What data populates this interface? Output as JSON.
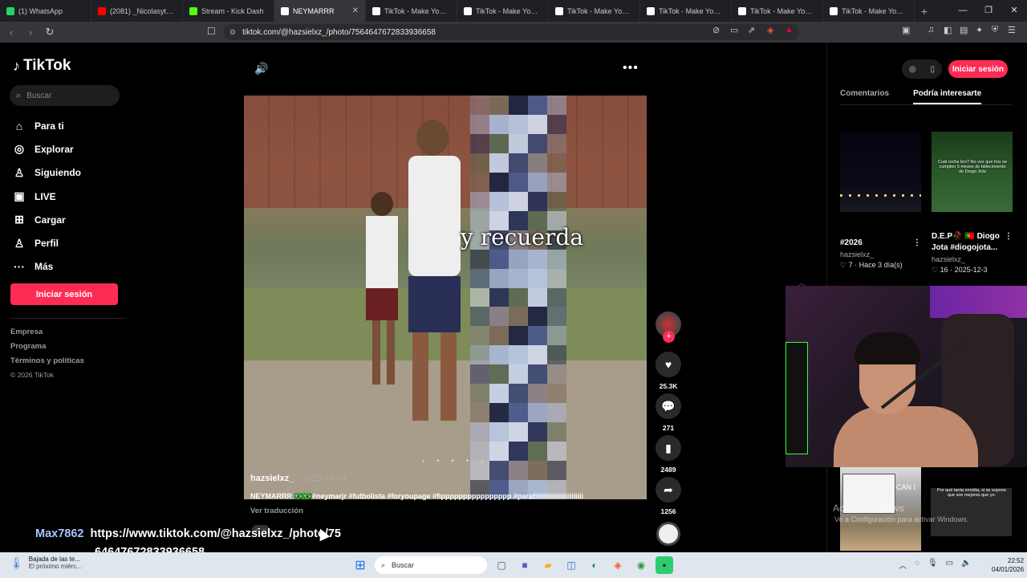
{
  "browser": {
    "tabs": [
      {
        "title": "(1) WhatsApp",
        "color": "#25d366",
        "active": false
      },
      {
        "title": "(2081) _Nicolasyt_ - Yo",
        "color": "#ff0000",
        "active": false
      },
      {
        "title": "Stream - Kick Dash",
        "color": "#53fc18",
        "active": false
      },
      {
        "title": "NEYMARRR",
        "color": "#ffffff",
        "active": true
      },
      {
        "title": "TikTok - Make Your Da",
        "color": "#ffffff",
        "active": false
      },
      {
        "title": "TikTok - Make Your Da",
        "color": "#ffffff",
        "active": false
      },
      {
        "title": "TikTok - Make Your Da",
        "color": "#ffffff",
        "active": false
      },
      {
        "title": "TikTok - Make Your Da",
        "color": "#ffffff",
        "active": false
      },
      {
        "title": "TikTok - Make Your Da",
        "color": "#ffffff",
        "active": false
      },
      {
        "title": "TikTok - Make Your Da",
        "color": "#ffffff",
        "active": false
      }
    ],
    "url": "tiktok.com/@hazsielxz_/photo/7564647672833936658"
  },
  "sidebar": {
    "logo": "TikTok",
    "search_placeholder": "Buscar",
    "items": [
      {
        "label": "Para ti",
        "icon": "home-icon",
        "glyph": "⌂"
      },
      {
        "label": "Explorar",
        "icon": "compass-icon",
        "glyph": "◎"
      },
      {
        "label": "Siguiendo",
        "icon": "following-icon",
        "glyph": "♙"
      },
      {
        "label": "LIVE",
        "icon": "live-icon",
        "glyph": "▣"
      },
      {
        "label": "Cargar",
        "icon": "upload-icon",
        "glyph": "⊞"
      },
      {
        "label": "Perfil",
        "icon": "profile-icon",
        "glyph": "♙"
      },
      {
        "label": "Más",
        "icon": "more-icon",
        "glyph": "···"
      }
    ],
    "login": "Iniciar sesión",
    "footer": [
      "Empresa",
      "Programa",
      "Términos y políticas"
    ],
    "copyright": "© 2026 TikTok"
  },
  "post": {
    "overlay_text": "y recuerda",
    "author": "hazsielxz_",
    "date": "2025-10-24",
    "caption": "NEYMARRR 🇧🇷🇧🇷#neymarjr #futbolista #foryoupage #fipppppppppppppppp #paratiiiiiiiiiiiiiiiiiiiiiiii",
    "translate": "Ver traducción",
    "likes": "25.3K",
    "comments": "271",
    "saves": "2489",
    "shares": "1256"
  },
  "panel": {
    "login": "Iniciar sesión",
    "tabs": [
      "Comentarios",
      "Podría interesarte"
    ],
    "cards": [
      {
        "title": "#2026",
        "user": "hazsielxz_",
        "meta": "♡ 7 · Hace 3 día(s)",
        "caption": ""
      },
      {
        "title": "D.E.P🥀 🇵🇹 Diogo Jota #diogojota...",
        "user": "hazsielxz_",
        "meta": "♡ 16 · 2025-12-3",
        "caption": "Cuál rocha bro? No vez que hoy se cumplen 5 meses de fallecimiento de Diogo Jota"
      }
    ],
    "mini2_caption": "Por qué tanta envidia, si se supone que son mejores que yo.",
    "mini1_label": "CAN I",
    "activate": "Activar Windows",
    "activate_sub": "Ve a Configuración para activar Windows."
  },
  "chat": {
    "user": "Max7862",
    "message1": "https://www.tiktok.com/@hazsielxz_/photo/75",
    "message2": "64647672833936658"
  },
  "taskbar": {
    "weather_title": "Bajada de las te...",
    "weather_sub": "El próximo miérc...",
    "search": "Buscar",
    "time": "22:52",
    "date": "04/01/2026"
  }
}
